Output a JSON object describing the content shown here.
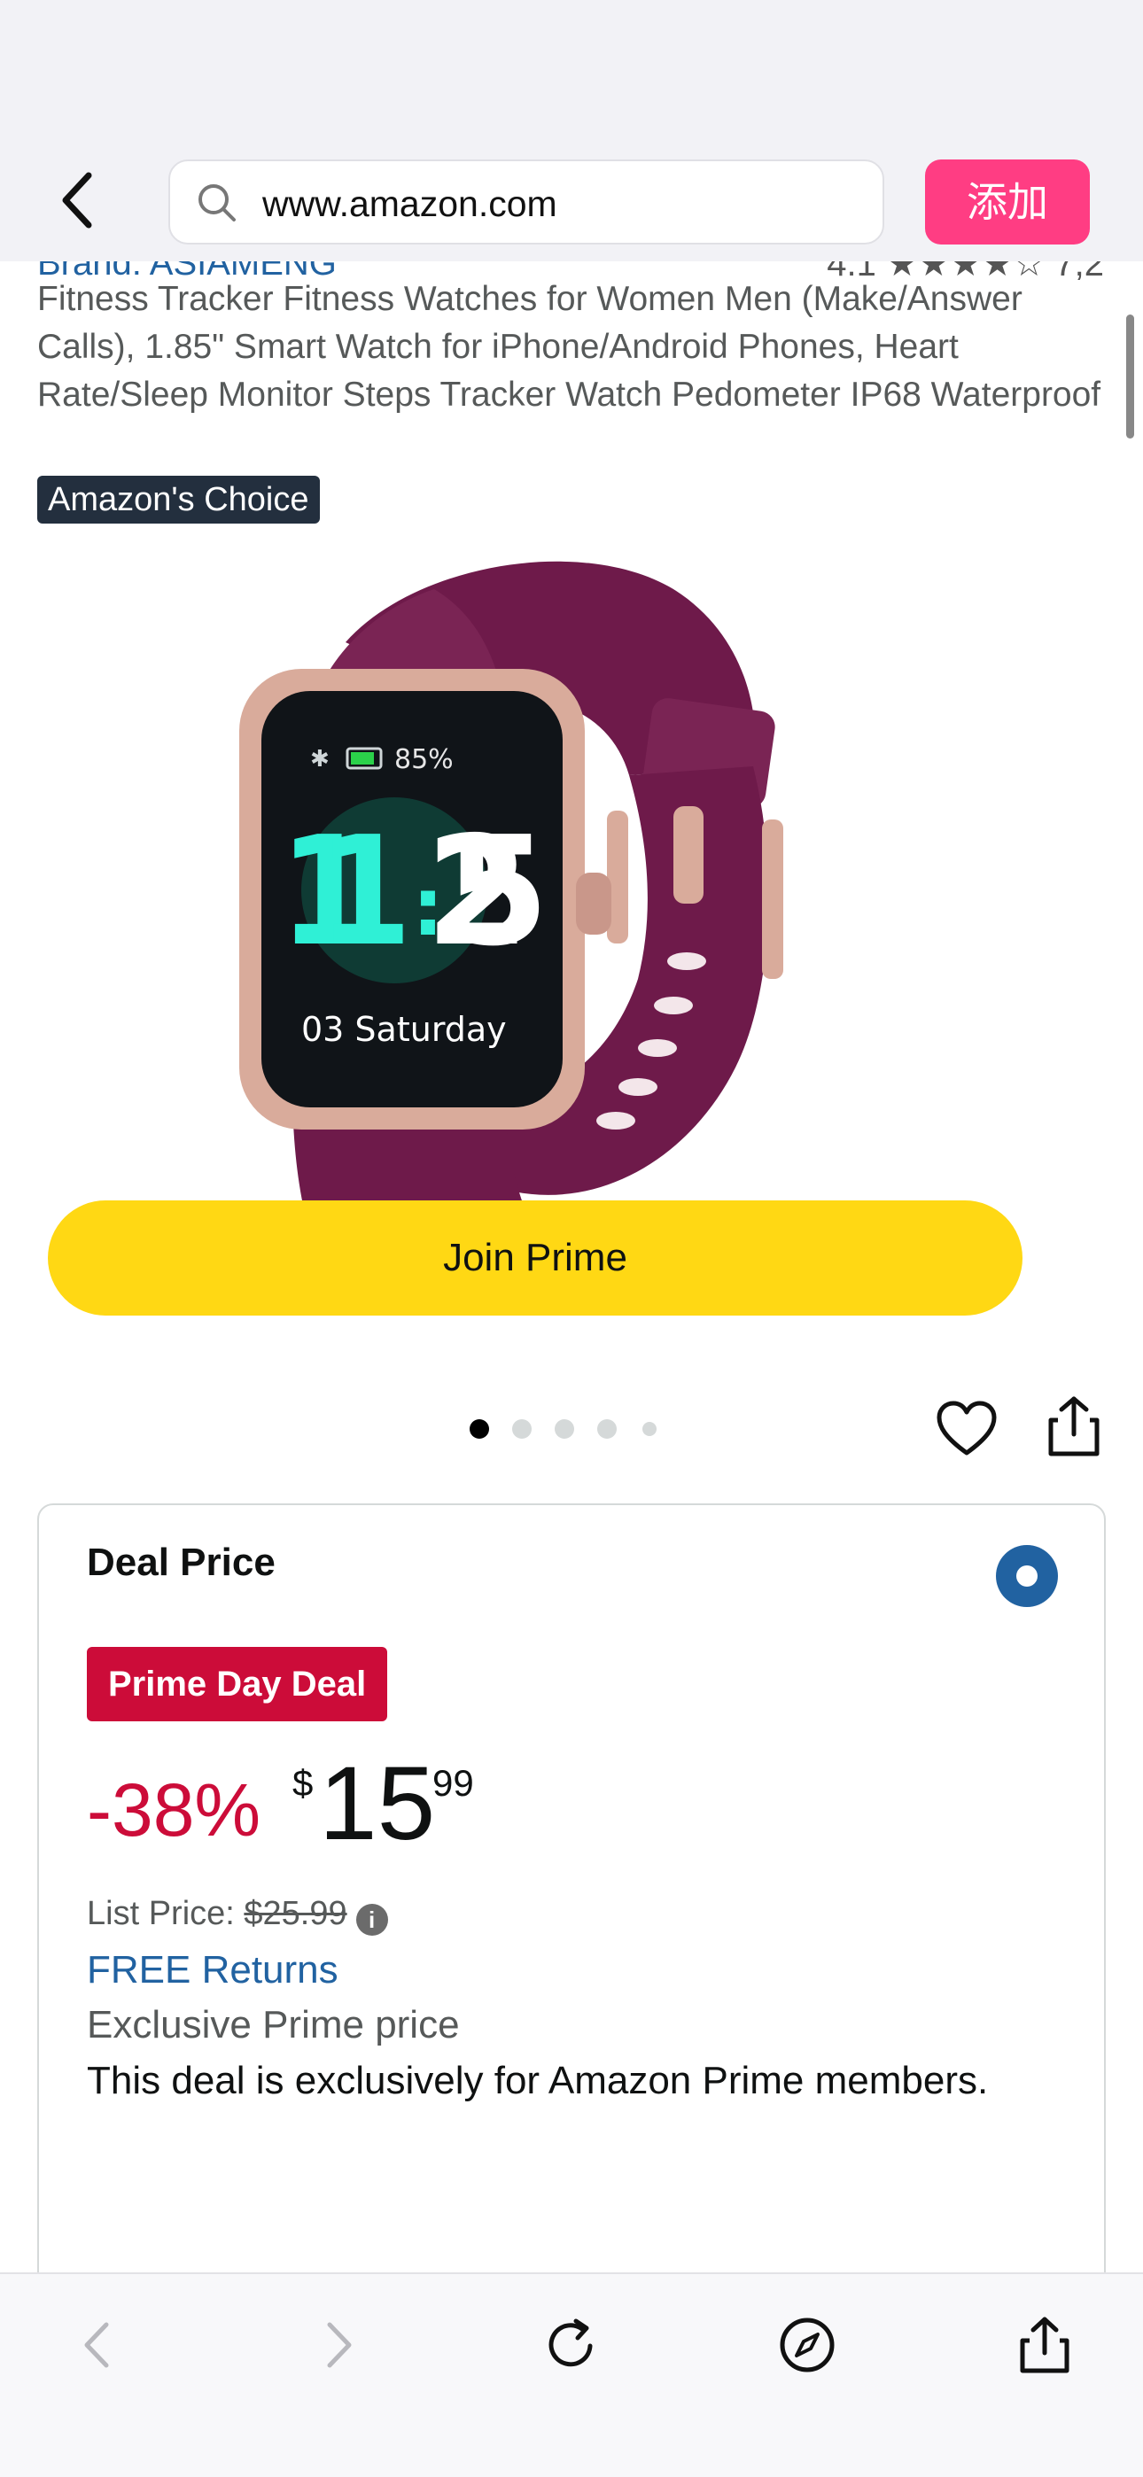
{
  "browser": {
    "url": "www.amazon.com",
    "add_button_label": "添加"
  },
  "product": {
    "brand_partial": "Brand: ASIAMENG",
    "rating_partial": "4.1 ★★★★☆ 7,2",
    "title": "Fitness Tracker Fitness Watches for Women Men (Make/Answer Calls), 1.85\" Smart Watch for iPhone/Android Phones, Heart Rate/Sleep Monitor Steps Tracker Watch Pedometer IP68 Waterproof",
    "badge": "Amazon's Choice",
    "image": {
      "watch_battery": "85%",
      "watch_hour": "11",
      "watch_minute": "25",
      "watch_date": "03  Saturday",
      "band_color": "#6e1a4a",
      "case_color": "#d9ab9b"
    },
    "carousel": {
      "total": 5,
      "active_index": 0
    }
  },
  "deal": {
    "label": "Deal Price",
    "badge": "Prime Day Deal",
    "discount": "-38%",
    "currency": "$",
    "price_whole": "15",
    "price_fraction": "99",
    "list_price_label": "List Price:",
    "list_price_value": "$25.99",
    "free_returns": "FREE Returns",
    "prime_price_label": "Exclusive Prime price",
    "description": "This deal is exclusively for Amazon Prime members.",
    "join_button": "Join Prime"
  },
  "colors": {
    "deal_red": "#cc0c39",
    "link_blue": "#2162a1",
    "join_yellow": "#ffd814",
    "add_pink": "#ff3d83"
  },
  "toolbar": {
    "icons": [
      "back-icon",
      "forward-icon",
      "reload-icon",
      "compass-icon",
      "share-icon"
    ]
  }
}
